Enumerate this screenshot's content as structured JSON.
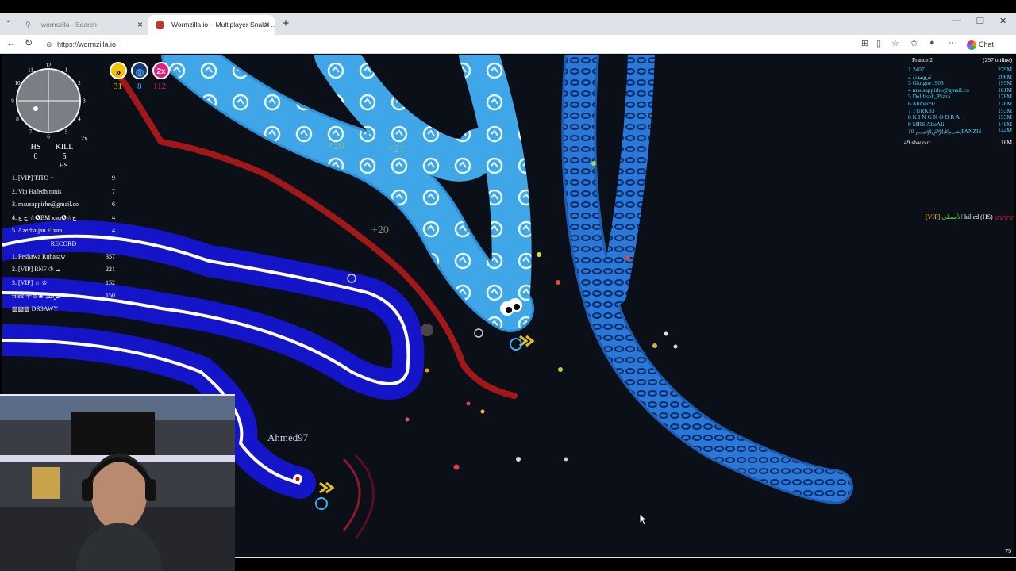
{
  "browser": {
    "tabs": [
      {
        "title": "wormzilla - Search",
        "active": false
      },
      {
        "title": "Wormzilla.io – Multiplayer Snake ...",
        "active": true
      }
    ],
    "new_tab": "+",
    "url": "https://wormzilla.io",
    "chat_label": "Chat"
  },
  "hud": {
    "hs_label": "HS",
    "kill_label": "KILL",
    "hs_value": "0",
    "kill_value": "5",
    "hs_sub_label": "HS",
    "zoom": "2x",
    "powerups": [
      {
        "icon": "speed-icon",
        "value": "31",
        "color": "#f5c400"
      },
      {
        "icon": "magnet-icon",
        "value": "8",
        "color": "#3ab0ff"
      },
      {
        "icon": "multiplier-icon",
        "label": "2x",
        "value": "112",
        "color": "#e0207a"
      }
    ],
    "minimap_numbers": [
      "12",
      "1",
      "2",
      "3",
      "4",
      "5",
      "6",
      "7",
      "8",
      "9",
      "10",
      "11"
    ]
  },
  "left_leaderboard": {
    "top": [
      {
        "name": "1. [VIP] TITO ··",
        "value": "9"
      },
      {
        "name": "2. Vip Hafedh tunis",
        "value": "7"
      },
      {
        "name": "3. mausappirhe@gmail.co",
        "value": "6"
      },
      {
        "name": "4. ج ع ☆✪BM κяα✪☆ج",
        "value": "4"
      },
      {
        "name": "5. Azerbaijan Elxan",
        "value": "4"
      }
    ],
    "record_label": "RECORD",
    "record": [
      {
        "name": "1. Peshawa Rubasaw",
        "value": "357"
      },
      {
        "name": "2. [VIP] RNF ♔ مـ",
        "value": "221"
      },
      {
        "name": "3. [VIP] ☆ ♔",
        "value": "152"
      },
      {
        "name": "тнєℓ 千 ϐ ❀ عزالك",
        "value": "150"
      },
      {
        "name": "▧▧▧ DR3AWY",
        "value": ""
      }
    ]
  },
  "right_leaderboard": {
    "server": "France 2",
    "online": "(297 online)",
    "rows": [
      {
        "name": "1  2407...",
        "value": "279M"
      },
      {
        "name": "2  تروییدن",
        "value": "206M"
      },
      {
        "name": "3  Gkngnv1903",
        "value": "195M"
      },
      {
        "name": "4  mausappirhe@gmail.co",
        "value": "181M"
      },
      {
        "name": "5  Delifisek_Pizza",
        "value": "178M"
      },
      {
        "name": "6  Ahmed97",
        "value": "176M"
      },
      {
        "name": "7  TURK33",
        "value": "153M"
      },
      {
        "name": "8  K I N G   K O B R A",
        "value": "153M"
      },
      {
        "name": "9  MRS AbuAli",
        "value": "149M"
      },
      {
        "name": "10  ﷽FANZIS",
        "value": "144M"
      }
    ],
    "me": {
      "name": "49  shaqour",
      "value": "16M"
    }
  },
  "killfeed": {
    "killer_prefix": "[VIP]",
    "killer_name": "الأسطى",
    "text": "killed (HS)",
    "victim": "۩۩۩۩"
  },
  "player": {
    "name": "Ahmed97"
  },
  "bonuses": [
    "+20",
    "+21",
    "+20"
  ],
  "fps": "75",
  "colors": {
    "background": "#0b0f18",
    "light_blue_snake": "#3fa6e8",
    "chain_snake": "#2a78d8",
    "player_snake": "#1a1ad0",
    "red_snake": "#a01818",
    "leader_cyan": "#4fd3ff",
    "vip_yellow": "#ffd21a",
    "kill_red": "#ff2020",
    "kill_green": "#40e040"
  }
}
